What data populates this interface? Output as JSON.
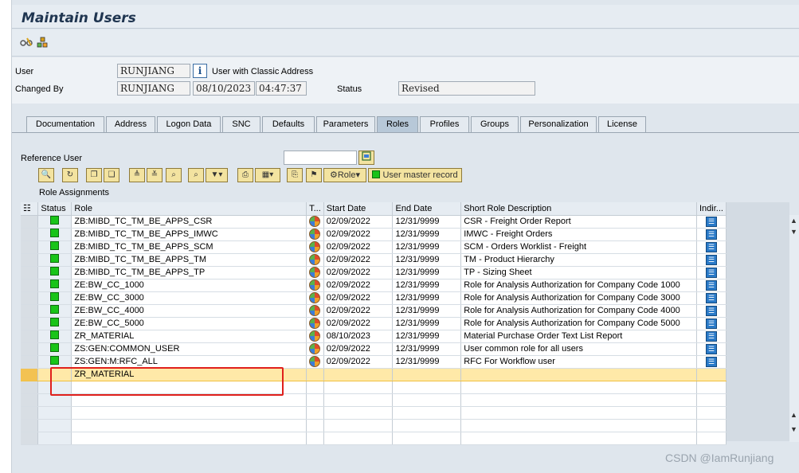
{
  "window": {
    "title": "Maintain Users"
  },
  "toolbar": {
    "icons": [
      "glasses-icon",
      "hierarchy-icon"
    ]
  },
  "header": {
    "user_label": "User",
    "user_value": "RUNJIANG",
    "user_info_icon": "i",
    "user_address_text": "User with Classic Address",
    "changed_by_label": "Changed By",
    "changed_by_value": "RUNJIANG",
    "changed_date": "08/10/2023",
    "changed_time": "04:47:37",
    "status_label": "Status",
    "status_value": "Revised"
  },
  "tabs": [
    {
      "label": "Documentation"
    },
    {
      "label": "Address"
    },
    {
      "label": "Logon Data"
    },
    {
      "label": "SNC"
    },
    {
      "label": "Defaults"
    },
    {
      "label": "Parameters"
    },
    {
      "label": "Roles"
    },
    {
      "label": "Profiles"
    },
    {
      "label": "Groups"
    },
    {
      "label": "Personalization"
    },
    {
      "label": "License"
    }
  ],
  "active_tab": "Roles",
  "roles_tab": {
    "reference_user_label": "Reference User",
    "reference_user_value": "",
    "role_button_label": "Role",
    "user_master_record_label": "User master record",
    "role_assignments_label": "Role Assignments"
  },
  "grid": {
    "columns": [
      "Status",
      "Role",
      "T...",
      "Start Date",
      "End Date",
      "Short Role Description",
      "Indir..."
    ],
    "rows": [
      {
        "role": "ZB:MIBD_TC_TM_BE_APPS_CSR",
        "start": "02/09/2022",
        "end": "12/31/9999",
        "desc": "CSR - Freight Order Report"
      },
      {
        "role": "ZB:MIBD_TC_TM_BE_APPS_IMWC",
        "start": "02/09/2022",
        "end": "12/31/9999",
        "desc": "IMWC - Freight Orders"
      },
      {
        "role": "ZB:MIBD_TC_TM_BE_APPS_SCM",
        "start": "02/09/2022",
        "end": "12/31/9999",
        "desc": "SCM - Orders Worklist - Freight"
      },
      {
        "role": "ZB:MIBD_TC_TM_BE_APPS_TM",
        "start": "02/09/2022",
        "end": "12/31/9999",
        "desc": "TM - Product Hierarchy"
      },
      {
        "role": "ZB:MIBD_TC_TM_BE_APPS_TP",
        "start": "02/09/2022",
        "end": "12/31/9999",
        "desc": "TP - Sizing Sheet"
      },
      {
        "role": "ZE:BW_CC_1000",
        "start": "02/09/2022",
        "end": "12/31/9999",
        "desc": "Role for Analysis Authorization for Company Code 1000"
      },
      {
        "role": "ZE:BW_CC_3000",
        "start": "02/09/2022",
        "end": "12/31/9999",
        "desc": "Role for Analysis Authorization for Company Code 3000"
      },
      {
        "role": "ZE:BW_CC_4000",
        "start": "02/09/2022",
        "end": "12/31/9999",
        "desc": "Role for Analysis Authorization for Company Code 4000"
      },
      {
        "role": "ZE:BW_CC_5000",
        "start": "02/09/2022",
        "end": "12/31/9999",
        "desc": "Role for Analysis Authorization for Company Code 5000"
      },
      {
        "role": "ZR_MATERIAL",
        "start": "08/10/2023",
        "end": "12/31/9999",
        "desc": "Material Purchase Order Text List Report"
      },
      {
        "role": "ZS:GEN:COMMON_USER",
        "start": "02/09/2022",
        "end": "12/31/9999",
        "desc": "User common role for all users"
      },
      {
        "role": "ZS:GEN:M:RFC_ALL",
        "start": "02/09/2022",
        "end": "12/31/9999",
        "desc": "RFC For Workflow user"
      }
    ],
    "input_row": {
      "role": "ZR_MATERIAL"
    },
    "empty_rows": 5
  },
  "colors": {
    "status_green": "#19c419",
    "highlight_row": "#ffe9a8",
    "annotation_red": "#e0201c"
  },
  "watermark": "CSDN @IamRunjiang"
}
